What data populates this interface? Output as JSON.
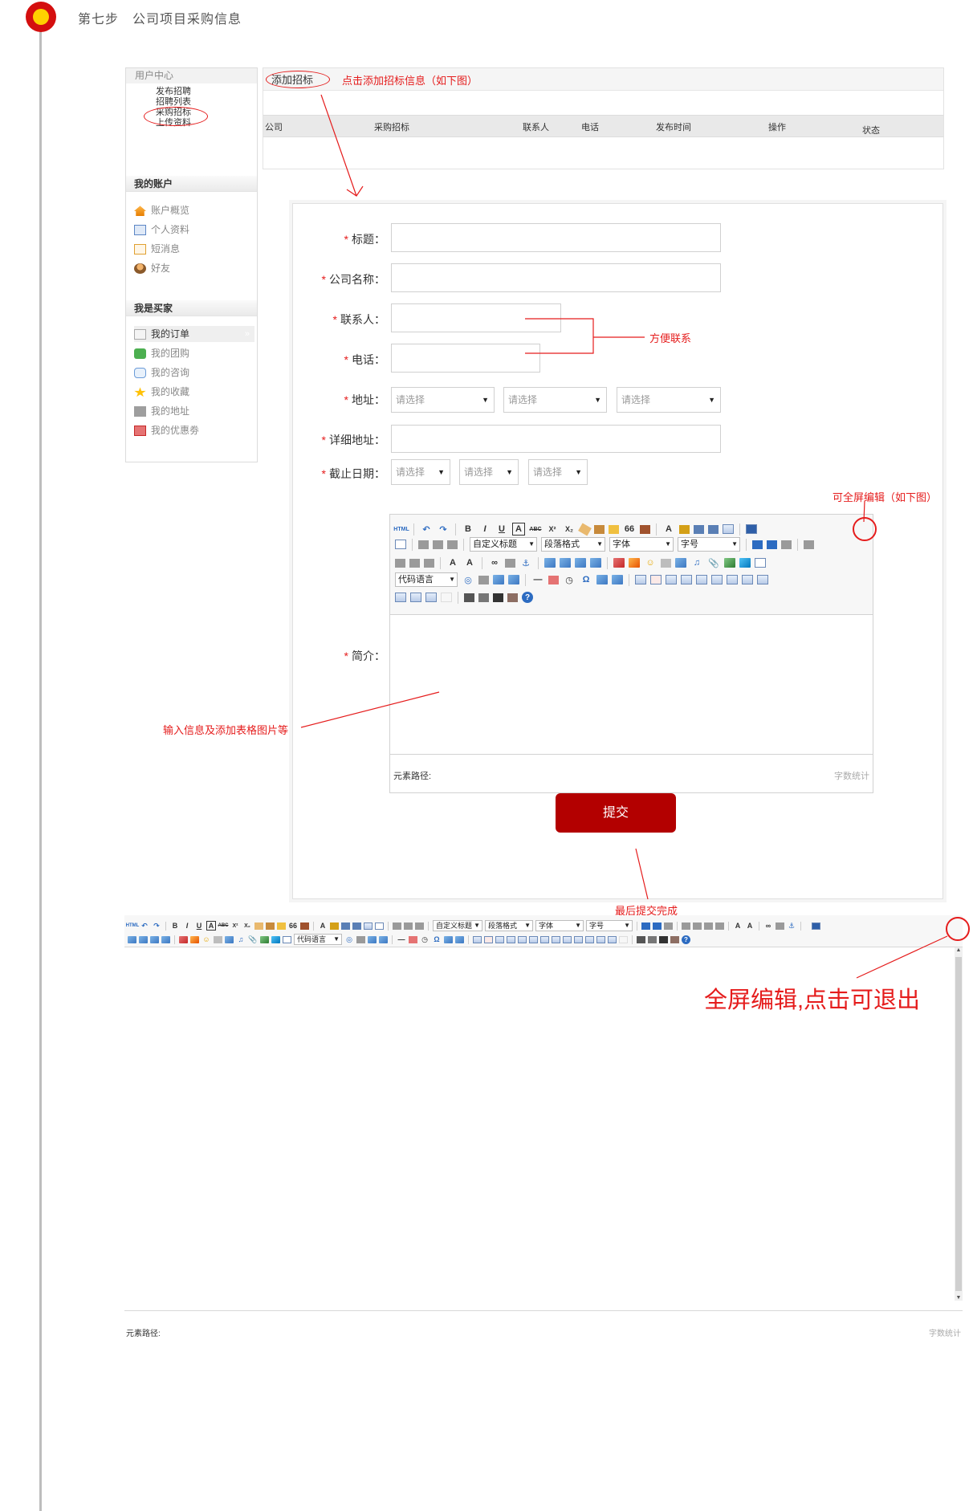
{
  "step": {
    "title": "第七步　公司项目采购信息"
  },
  "sidebar": {
    "header": "用户中心",
    "links": [
      "发布招聘",
      "招聘列表",
      "采购招标",
      "上传资料"
    ],
    "account_title": "我的账户",
    "account_items": [
      "账户概览",
      "个人资料",
      "短消息",
      "好友"
    ],
    "buyer_title": "我是买家",
    "buyer_items": [
      "我的订单",
      "我的团购",
      "我的咨询",
      "我的收藏",
      "我的地址",
      "我的优惠劵"
    ],
    "active_chevron": "»"
  },
  "top_panel": {
    "add_button": "添加招标",
    "note": "点击添加招标信息（如下图）",
    "columns": [
      "公司",
      "采购招标",
      "联系人",
      "电话",
      "发布时间",
      "操作",
      "状态"
    ]
  },
  "form": {
    "required_mark": "*",
    "title_label": "标题：",
    "company_label": "公司名称：",
    "contact_label": "联系人：",
    "phone_label": "电话：",
    "address_label": "地址：",
    "detail_address_label": "详细地址：",
    "deadline_label": "截止日期：",
    "intro_label": "简介：",
    "select_placeholder": "请选择",
    "select_arrow": "▼",
    "submit": "提交"
  },
  "editor": {
    "html_label": "HTML",
    "custom_heading": "自定义标题",
    "paragraph_format": "段落格式",
    "font": "字体",
    "font_size": "字号",
    "code_language": "代码语言",
    "element_path": "元素路径:",
    "word_count": "字数统计",
    "icons": {
      "bold": "B",
      "italic": "I",
      "underline": "U",
      "font_border": "A",
      "strike": "ABC",
      "superscript": "X²",
      "subscript": "X₂",
      "quote": "66",
      "font_color": "A",
      "omega": "Ω",
      "anchor": "⚓",
      "link": "∞",
      "minus": "—",
      "help": "?",
      "undo": "↶",
      "redo": "↷"
    }
  },
  "annotations": {
    "contact_note": "方便联系",
    "fullscreen_note": "可全屏编辑（如下图）",
    "input_note": "输入信息及添加表格图片等",
    "submit_note": "最后提交完成",
    "exit_note": "全屏编辑,点击可退出"
  },
  "colors": {
    "accent_red": "#e51c1c",
    "submit_bg": "#b30000",
    "dot_yellow": "#ffd200"
  }
}
